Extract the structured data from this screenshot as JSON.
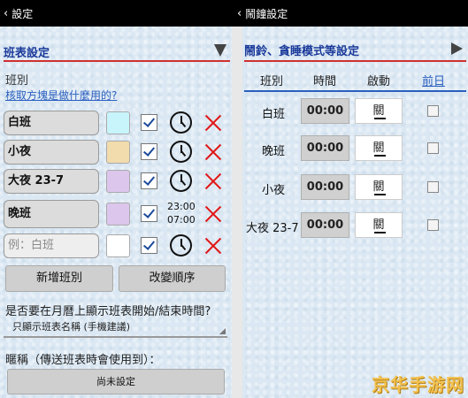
{
  "left_panel": {
    "back_label": "設定",
    "section_title": "班表設定",
    "shift_label": "班別",
    "help_link": "核取方塊是做什麼用的?",
    "shifts": [
      {
        "name": "白班",
        "color": "#c8f4fb"
      },
      {
        "name": "小夜",
        "color": "#f2dcae"
      },
      {
        "name": "大夜 23-7",
        "color": "#dcc6ec"
      },
      {
        "name": "晚班",
        "color": "#dcc6ec",
        "start": "23:00",
        "end": "07:00"
      }
    ],
    "placeholder": "例：白班",
    "add_button": "新增班別",
    "reorder_button": "改變順序",
    "question": "是否要在月曆上顯示班表開始/結束時間?",
    "select_value": "只顯示班表名稱 (手機建議)",
    "nickname_label": "暱稱（傳送班表時會使用到）：",
    "nickname_button": "尚未設定"
  },
  "right_panel": {
    "back_label": "鬧鐘設定",
    "section_title": "鬧鈴、貪睡模式等設定",
    "columns": {
      "shift": "班別",
      "time": "時間",
      "enable": "啟動",
      "prev_day": "前日"
    },
    "rows": [
      {
        "name": "白班",
        "time": "00:00",
        "toggle": "關"
      },
      {
        "name": "晚班",
        "time": "00:00",
        "toggle": "關"
      },
      {
        "name": "小夜",
        "time": "00:00",
        "toggle": "關"
      },
      {
        "name": "大夜 23-7",
        "time": "00:00",
        "toggle": "關"
      }
    ]
  },
  "watermark": "京华手游网"
}
